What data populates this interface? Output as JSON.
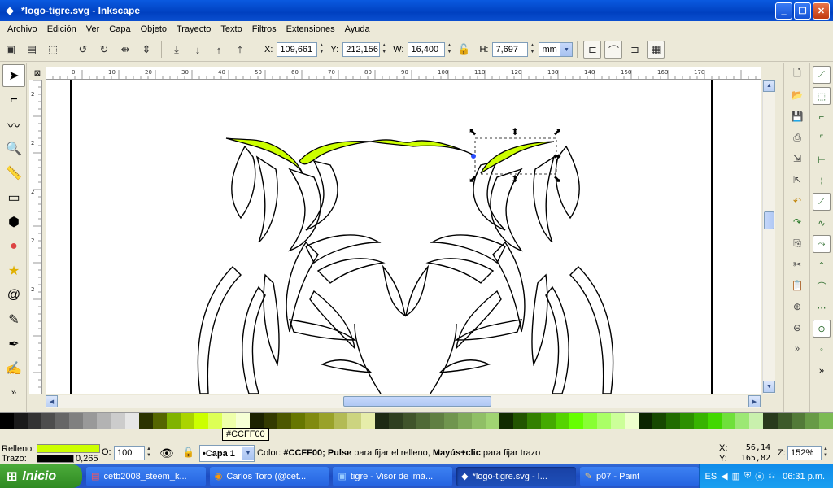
{
  "window": {
    "title": "*logo-tigre.svg - Inkscape",
    "icon": "inkscape-icon"
  },
  "menu": [
    "Archivo",
    "Edición",
    "Ver",
    "Capa",
    "Objeto",
    "Trayecto",
    "Texto",
    "Filtros",
    "Extensiones",
    "Ayuda"
  ],
  "controls": {
    "x_label": "X:",
    "x_value": "109,661",
    "y_label": "Y:",
    "y_value": "212,156",
    "w_label": "W:",
    "w_value": "16,400",
    "h_label": "H:",
    "h_value": "7,697",
    "unit": "mm"
  },
  "ruler": {
    "h_ticks": [
      "0",
      "10",
      "20",
      "30",
      "40",
      "50",
      "60",
      "70",
      "80",
      "90",
      "100",
      "110",
      "120",
      "130",
      "140",
      "150",
      "160",
      "170"
    ],
    "v_ticks": [
      "2",
      "2",
      "2",
      "2",
      "2"
    ]
  },
  "palette": [
    "#000000",
    "#1a1a1a",
    "#333333",
    "#4d4d4d",
    "#666666",
    "#808080",
    "#999999",
    "#b3b3b3",
    "#cccccc",
    "#e6e6e6",
    "#2b3300",
    "#556600",
    "#80b300",
    "#aad400",
    "#ccff00",
    "#ddff55",
    "#eeffaa",
    "#f6ffd5",
    "#1c2200",
    "#333a00",
    "#4d5800",
    "#667600",
    "#808a10",
    "#99a22a",
    "#b3bb55",
    "#ccd480",
    "#e6edaa",
    "#1e2a14",
    "#2f3f20",
    "#40542b",
    "#506a37",
    "#607f42",
    "#70954e",
    "#80aa5a",
    "#90bf66",
    "#a0d472",
    "#112b00",
    "#225500",
    "#338000",
    "#44aa00",
    "#55d400",
    "#66ff00",
    "#88ff33",
    "#aaff66",
    "#ccff99",
    "#eeffcc",
    "#0b2400",
    "#164800",
    "#216c00",
    "#2c9000",
    "#37b400",
    "#42d800",
    "#6fe03a",
    "#9ce874",
    "#c9f0ad",
    "#283a1c",
    "#3d5a2a",
    "#527a38",
    "#679a46",
    "#7cba54"
  ],
  "tooltip": "#CCFF00",
  "status": {
    "fill_label": "Relleno:",
    "fill_color": "#CCFF00",
    "stroke_label": "Trazo:",
    "stroke_color": "#000000",
    "stroke_width": "0,265",
    "opacity_label": "O:",
    "opacity_value": "100",
    "layer": "•Capa 1",
    "message_pre": "Color: ",
    "message_color": "#CCFF00;",
    "message_mid1": " ",
    "message_pulse": "Pulse",
    "message_mid2": " para fijar el relleno, ",
    "message_shift": "Mayús+clic",
    "message_end": " para fijar trazo",
    "x_label": "X:",
    "x_value": "56,14",
    "y_label": "Y:",
    "y_value": "165,82",
    "zoom_label": "Z:",
    "zoom_value": "152%"
  },
  "taskbar": {
    "start": "Inicio",
    "tasks": [
      "cetb2008_steem_k...",
      "Carlos Toro (@cet...",
      "tigre - Visor de imá...",
      "*logo-tigre.svg - I...",
      "p07 - Paint"
    ],
    "active_index": 3,
    "lang": "ES",
    "clock": "06:31 p.m."
  },
  "accent": "#ccff00"
}
